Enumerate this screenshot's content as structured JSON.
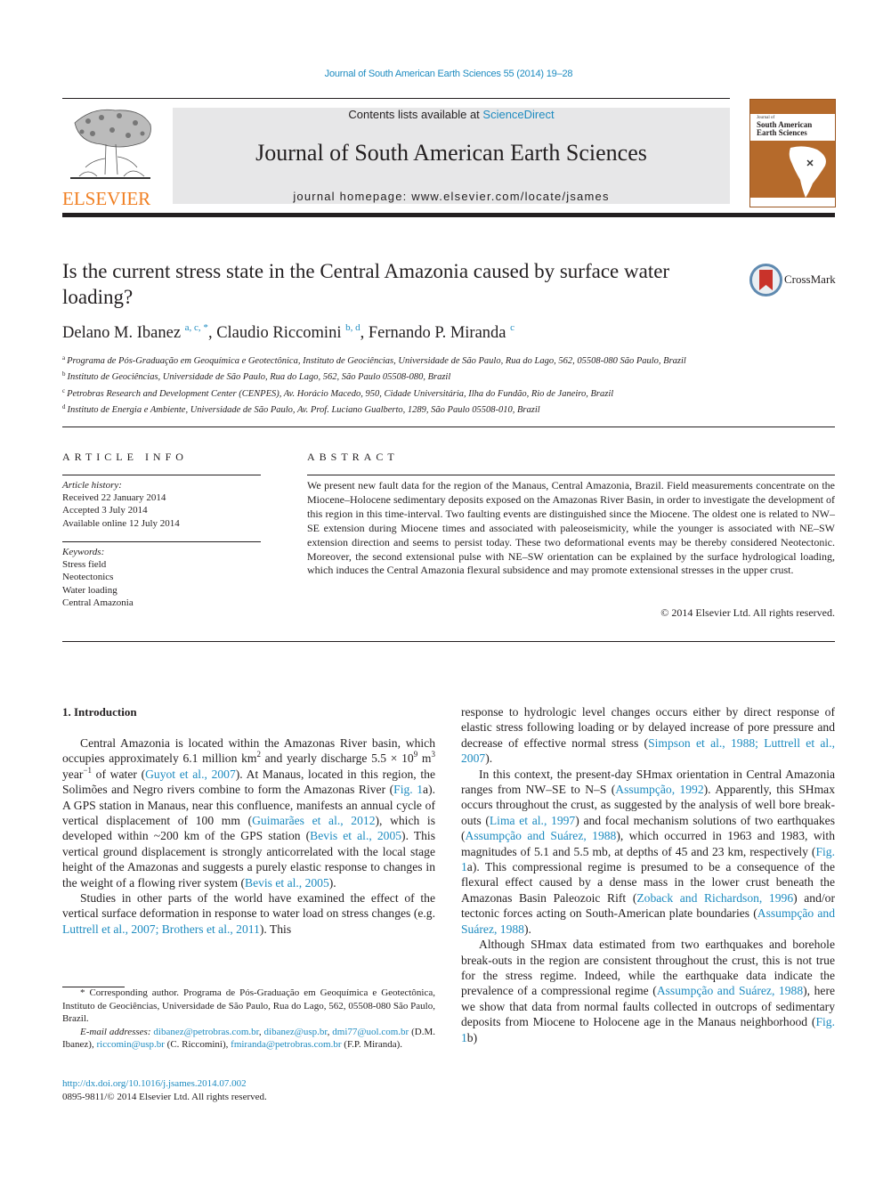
{
  "header": {
    "citation": "Journal of South American Earth Sciences 55 (2014) 19–28",
    "contents_prefix": "Contents lists available at ",
    "contents_link": "ScienceDirect",
    "journal_title": "Journal of South American Earth Sciences",
    "homepage": "journal homepage: www.elsevier.com/locate/jsames",
    "publisher_logo_text": "ELSEVIER",
    "cover": {
      "small_label": "Journal of",
      "title_line1": "South American",
      "title_line2": "Earth Sciences"
    },
    "colors": {
      "link": "#1d8bc0",
      "elsevier_orange": "#f07f22",
      "cover_brown": "#b56a2b",
      "banner_gray": "#e7e7e8"
    }
  },
  "article": {
    "title": "Is the current stress state in the Central Amazonia caused by surface water loading?",
    "crossmark_label": "CrossMark",
    "authors": [
      {
        "name": "Delano M. Ibanez",
        "sup": "a, c, *"
      },
      {
        "name": "Claudio Riccomini",
        "sup": "b, d"
      },
      {
        "name": "Fernando P. Miranda",
        "sup": "c"
      }
    ],
    "affiliations": [
      {
        "key": "a",
        "text": "Programa de Pós-Graduação em Geoquímica e Geotectônica, Instituto de Geociências, Universidade de São Paulo, Rua do Lago, 562, 05508-080 São Paulo, Brazil"
      },
      {
        "key": "b",
        "text": "Instituto de Geociências, Universidade de São Paulo, Rua do Lago, 562, São Paulo 05508-080, Brazil"
      },
      {
        "key": "c",
        "text": "Petrobras Research and Development Center (CENPES), Av. Horácio Macedo, 950, Cidade Universitária, Ilha do Fundão, Rio de Janeiro, Brazil"
      },
      {
        "key": "d",
        "text": "Instituto de Energia e Ambiente, Universidade de São Paulo, Av. Prof. Luciano Gualberto, 1289, São Paulo 05508-010, Brazil"
      }
    ]
  },
  "article_info": {
    "heading": "ARTICLE INFO",
    "history_label": "Article history:",
    "history": [
      "Received 22 January 2014",
      "Accepted 3 July 2014",
      "Available online 12 July 2014"
    ],
    "keywords_label": "Keywords:",
    "keywords": [
      "Stress field",
      "Neotectonics",
      "Water loading",
      "Central Amazonia"
    ]
  },
  "abstract": {
    "heading": "ABSTRACT",
    "text": "We present new fault data for the region of the Manaus, Central Amazonia, Brazil. Field measurements concentrate on the Miocene–Holocene sedimentary deposits exposed on the Amazonas River Basin, in order to investigate the development of this region in this time-interval. Two faulting events are distinguished since the Miocene. The oldest one is related to NW–SE extension during Miocene times and associated with paleoseismicity, while the younger is associated with NE–SW extension direction and seems to persist today. These two deformational events may be thereby considered Neotectonic. Moreover, the second extensional pulse with NE–SW orientation can be explained by the surface hydrological loading, which induces the Central Amazonia flexural subsidence and may promote extensional stresses in the upper crust.",
    "copyright": "© 2014 Elsevier Ltd. All rights reserved."
  },
  "body": {
    "section_heading": "1.  Introduction",
    "left": {
      "p1": {
        "t1": "Central Amazonia is located within the Amazonas River basin, which occupies approximately 6.1 million km",
        "sup1": "2",
        "t2": " and yearly discharge 5.5 × 10",
        "sup2": "9",
        "t3": " m",
        "sup3": "3",
        "t4": " year",
        "sup4": "−1",
        "t5": " of water (",
        "ref1": "Guyot et al., 2007",
        "t6": "). At Manaus, located in this region, the Solimões and Negro rivers combine to form the Amazonas River (",
        "ref2": "Fig. 1",
        "t7": "a). A GPS station in Manaus, near this confluence, manifests an annual cycle of vertical displacement of 100 mm (",
        "ref3": "Guimarães et al., 2012",
        "t8": "), which is developed within ~200 km of the GPS station (",
        "ref4": "Bevis et al., 2005",
        "t9": "). This vertical ground displacement is strongly anticorrelated with the local stage height of the Amazonas and suggests a purely elastic response to changes in the weight of a flowing river system (",
        "ref5": "Bevis et al., 2005",
        "t10": ")."
      },
      "p2": {
        "t1": "Studies in other parts of the world have examined the effect of the vertical surface deformation in response to water load on stress changes (e.g. ",
        "ref1": "Luttrell et al., 2007; Brothers et al., 2011",
        "t2": "). This"
      }
    },
    "right": {
      "p1": {
        "t1": "response to hydrologic level changes occurs either by direct response of elastic stress following loading or by delayed increase of pore pressure and decrease of effective normal stress (",
        "ref1": "Simpson et al., 1988; Luttrell et al., 2007",
        "t2": ")."
      },
      "p2": {
        "t1": "In this context, the present-day SHmax orientation in Central Amazonia ranges from NW–SE to N–S (",
        "ref1": "Assumpção, 1992",
        "t2": "). Apparently, this SHmax occurs throughout the crust, as suggested by the analysis of well bore break-outs (",
        "ref2": "Lima et al., 1997",
        "t3": ") and focal mechanism solutions of two earthquakes (",
        "ref3": "Assumpção and Suárez, 1988",
        "t4": "), which occurred in 1963 and 1983, with magnitudes of 5.1 and 5.5 mb, at depths of 45 and 23 km, respectively (",
        "ref4": "Fig. 1",
        "t5": "a). This compressional regime is presumed to be a consequence of the flexural effect caused by a dense mass in the lower crust beneath the Amazonas Basin Paleozoic Rift (",
        "ref5": "Zoback and Richardson, 1996",
        "t6": ") and/or tectonic forces acting on South-American plate boundaries (",
        "ref6": "Assumpção and Suárez, 1988",
        "t7": ")."
      },
      "p3": {
        "t1": "Although SHmax data estimated from two earthquakes and borehole break-outs in the region are consistent throughout the crust, this is not true for the stress regime. Indeed, while the earthquake data indicate the prevalence of a compressional regime (",
        "ref1": "Assumpção and Suárez, 1988",
        "t2": "), here we show that data from normal faults collected in outcrops of sedimentary deposits from Miocene to Holocene age in the Manaus neighborhood (",
        "ref2": "Fig. 1",
        "t3": "b)"
      }
    }
  },
  "footnote": {
    "corresponding": "* Corresponding author. Programa de Pós-Graduação em Geoquímica e Geotectônica, Instituto de Geociências, Universidade de São Paulo, Rua do Lago, 562, 05508-080 São Paulo, Brazil.",
    "email_label": "E-mail addresses:",
    "emails": [
      {
        "address": "dibanez@petrobras.com.br",
        "after": ", "
      },
      {
        "address": "dibanez@usp.br",
        "after": ", "
      },
      {
        "address": "dmi77@uol.com.br",
        "after": " (D.M. Ibanez), "
      },
      {
        "address": "riccomin@usp.br",
        "after": " (C. Riccomini), "
      },
      {
        "address": "fmiranda@petrobras.com.br",
        "after": " (F.P. Miranda)."
      }
    ],
    "doi": "http://dx.doi.org/10.1016/j.jsames.2014.07.002",
    "issn": "0895-9811/© 2014 Elsevier Ltd. All rights reserved."
  }
}
